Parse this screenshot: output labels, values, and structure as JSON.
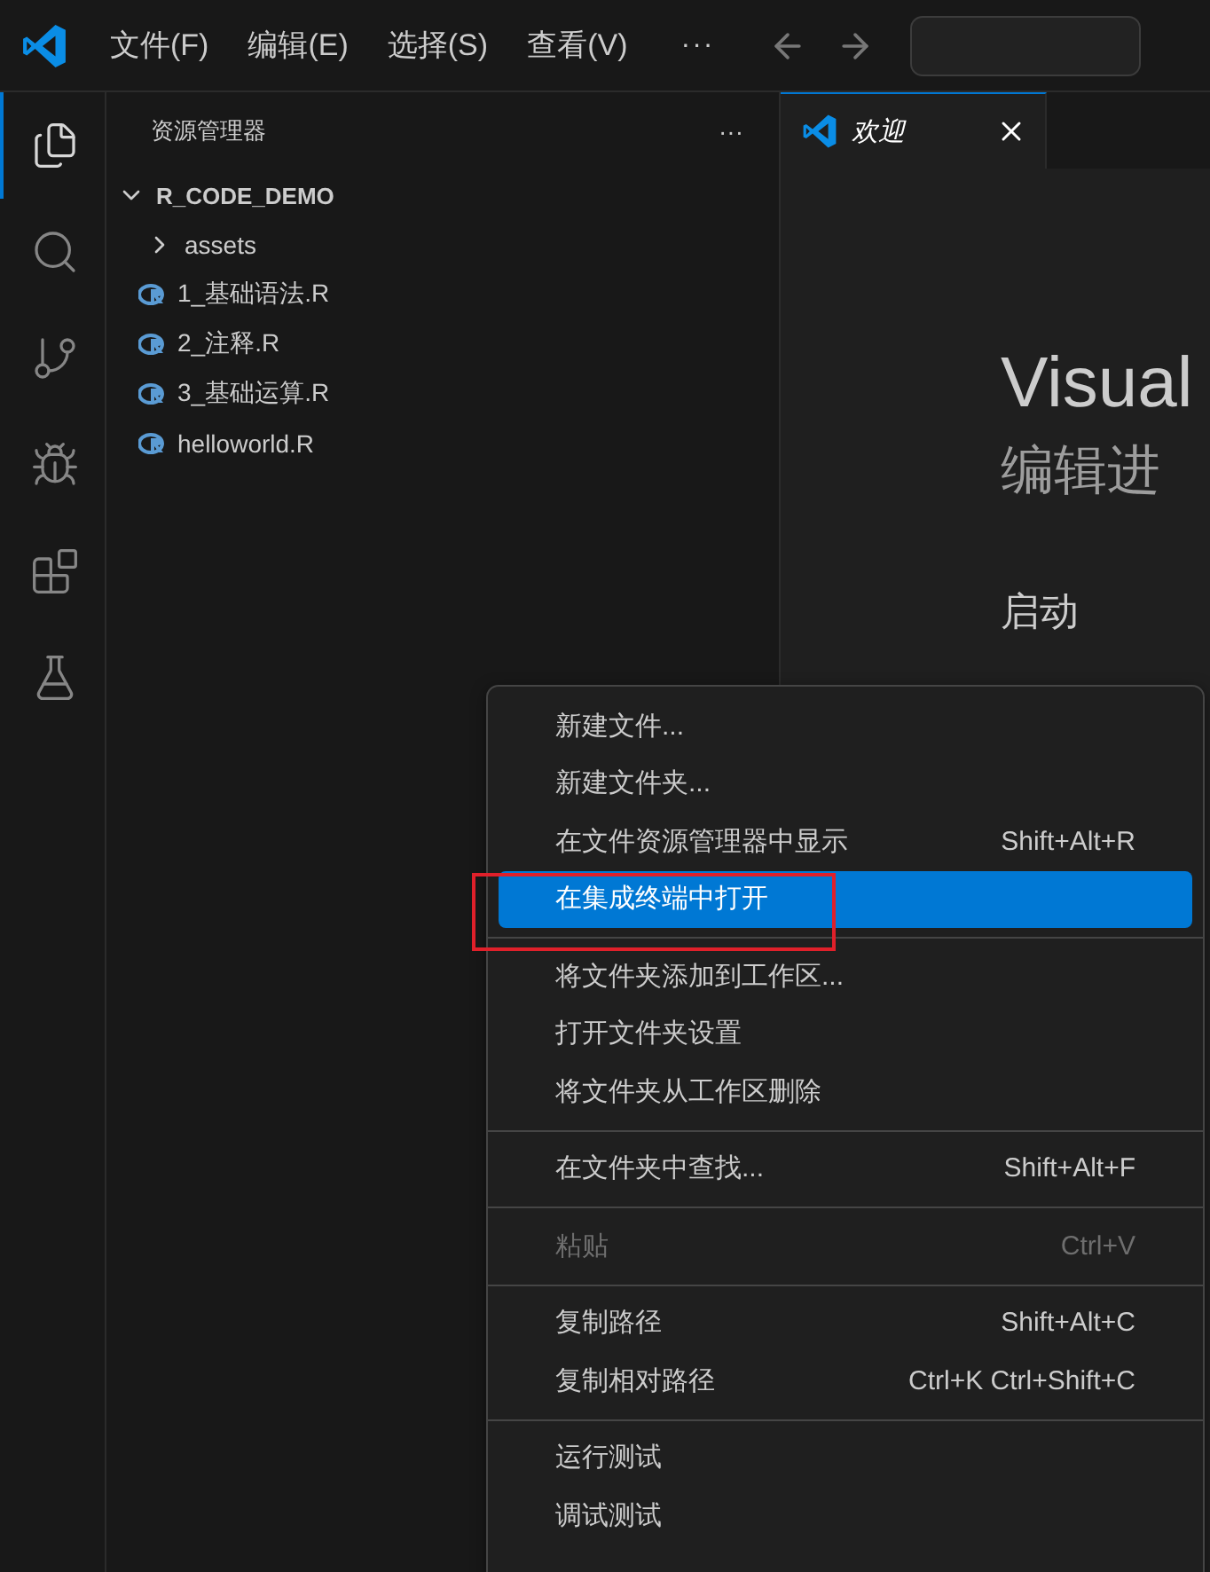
{
  "menubar": {
    "items": [
      "文件(F)",
      "编辑(E)",
      "选择(S)",
      "查看(V)"
    ],
    "more": "···"
  },
  "activity_bar": [
    {
      "kind": "explorer",
      "selected": true
    },
    {
      "kind": "search",
      "selected": false
    },
    {
      "kind": "source-control",
      "selected": false
    },
    {
      "kind": "run-debug",
      "selected": false
    },
    {
      "kind": "extensions",
      "selected": false
    },
    {
      "kind": "testing",
      "selected": false
    }
  ],
  "sidebar": {
    "title": "资源管理器",
    "more": "···",
    "folder": {
      "name": "R_CODE_DEMO",
      "expanded": true,
      "children": [
        {
          "name": "assets",
          "kind": "folder",
          "expanded": false
        },
        {
          "name": "1_基础语法.R",
          "kind": "r-file"
        },
        {
          "name": "2_注释.R",
          "kind": "r-file"
        },
        {
          "name": "3_基础运算.R",
          "kind": "r-file"
        },
        {
          "name": "helloworld.R",
          "kind": "r-file"
        }
      ]
    }
  },
  "tabs": [
    {
      "label": "欢迎",
      "selected": true
    }
  ],
  "welcome": {
    "title": "Visual",
    "subtitle": "编辑进",
    "section": "启动"
  },
  "context_menu": [
    [
      {
        "label": "新建文件...",
        "selected": false,
        "disabled": false
      },
      {
        "label": "新建文件夹...",
        "selected": false,
        "disabled": false
      },
      {
        "label": "在文件资源管理器中显示",
        "shortcut": "Shift+Alt+R",
        "selected": false,
        "disabled": false
      },
      {
        "label": "在集成终端中打开",
        "selected": true,
        "disabled": false,
        "annotated": true
      }
    ],
    [
      {
        "label": "将文件夹添加到工作区...",
        "selected": false,
        "disabled": false
      },
      {
        "label": "打开文件夹设置",
        "selected": false,
        "disabled": false
      },
      {
        "label": "将文件夹从工作区删除",
        "selected": false,
        "disabled": false
      }
    ],
    [
      {
        "label": "在文件夹中查找...",
        "shortcut": "Shift+Alt+F",
        "selected": false,
        "disabled": false
      }
    ],
    [
      {
        "label": "粘贴",
        "shortcut": "Ctrl+V",
        "selected": false,
        "disabled": true
      }
    ],
    [
      {
        "label": "复制路径",
        "shortcut": "Shift+Alt+C",
        "selected": false,
        "disabled": false
      },
      {
        "label": "复制相对路径",
        "shortcut": "Ctrl+K Ctrl+Shift+C",
        "selected": false,
        "disabled": false
      }
    ],
    [
      {
        "label": "运行测试",
        "selected": false,
        "disabled": false
      },
      {
        "label": "调试测试",
        "selected": false,
        "disabled": false
      }
    ]
  ]
}
